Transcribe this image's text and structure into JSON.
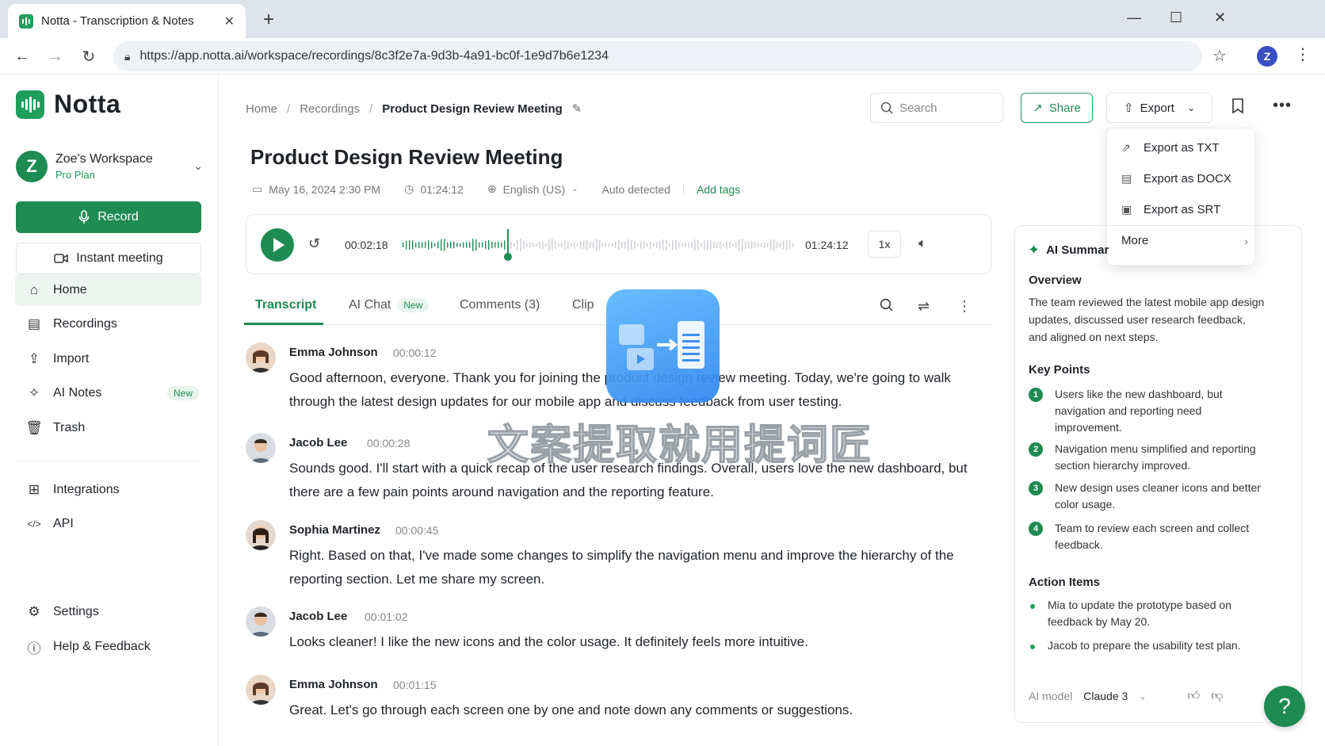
{
  "browser": {
    "tab_title": "Notta - Transcription & Notes",
    "url": "https://app.notta.ai/workspace/recordings/8c3f2e7a-9d3b-4a91-bc0f-1e9d7b6e1234",
    "profile_initial": "Z"
  },
  "sidebar": {
    "brand": "Notta",
    "workspace_name": "Zoe's Workspace",
    "workspace_plan": "Pro Plan",
    "workspace_initial": "Z",
    "record_label": "Record",
    "instant_label": "Instant meeting",
    "nav": [
      {
        "label": "Home",
        "icon": "home-icon"
      },
      {
        "label": "Recordings",
        "icon": "document-icon"
      },
      {
        "label": "Import",
        "icon": "upload-icon"
      },
      {
        "label": "AI Notes",
        "icon": "sparkle-icon",
        "badge": "New"
      },
      {
        "label": "Trash",
        "icon": "trash-icon"
      },
      {
        "label": "Integrations",
        "icon": "grid-icon"
      },
      {
        "label": "API",
        "icon": "code-icon"
      },
      {
        "label": "Settings",
        "icon": "gear-icon"
      },
      {
        "label": "Help & Feedback",
        "icon": "help-icon"
      }
    ]
  },
  "header": {
    "breadcrumb": [
      "Home",
      "Recordings",
      "Product Design Review Meeting"
    ],
    "search_placeholder": "Search",
    "share_label": "Share",
    "export_label": "Export"
  },
  "recording": {
    "title": "Product Design Review Meeting",
    "date": "May 16, 2024 2:30 PM",
    "duration": "01:24:12",
    "language": "English (US)",
    "detection": "Auto detected",
    "add_tags": "Add tags"
  },
  "player": {
    "current_time": "00:02:18",
    "total_time": "01:24:12",
    "speed": "1x",
    "progress": 0.27
  },
  "tabs": [
    {
      "label": "Transcript"
    },
    {
      "label": "AI Chat",
      "badge": "New"
    },
    {
      "label": "Comments (3)"
    },
    {
      "label": "Clip"
    }
  ],
  "transcript": [
    {
      "speaker": "Emma Johnson",
      "time": "00:00:12",
      "text": "Good afternoon, everyone. Thank you for joining the product design review meeting. Today, we're going to walk through the latest design updates for our mobile app and discuss feedback from user testing."
    },
    {
      "speaker": "Jacob Lee",
      "time": "00:00:28",
      "text": "Sounds good. I'll start with a quick recap of the user research findings. Overall, users love the new dashboard, but there are a few pain points around navigation and the reporting feature."
    },
    {
      "speaker": "Sophia Martinez",
      "time": "00:00:45",
      "text": "Right. Based on that, I've made some changes to simplify the navigation menu and improve the hierarchy of the reporting section. Let me share my screen."
    },
    {
      "speaker": "Jacob Lee",
      "time": "00:01:02",
      "text": "Looks cleaner! I like the new icons and the color usage. It definitely feels more intuitive."
    },
    {
      "speaker": "Emma Johnson",
      "time": "00:01:15",
      "text": "Great. Let's go through each screen one by one and note down any comments or suggestions."
    }
  ],
  "overlay_text": "文案提取就用提词匠",
  "summary": {
    "title": "AI Summar",
    "overview_heading": "Overview",
    "overview": "The team reviewed the latest mobile app design updates, discussed user research feedback, and aligned on next steps.",
    "keypoints_heading": "Key Points",
    "keypoints": [
      {
        "num": "1",
        "text": "Users like the new dashboard, but navigation and reporting need improvement."
      },
      {
        "num": "2",
        "text": "Navigation menu simplified and reporting section hierarchy improved."
      },
      {
        "num": "3",
        "text": "New design uses cleaner icons and better color usage."
      },
      {
        "num": "4",
        "text": "Team to review each screen and collect feedback."
      }
    ],
    "actions_heading": "Action Items",
    "actions": [
      "Mia to update the prototype based on feedback by May 20.",
      "Jacob to prepare the usability test plan."
    ],
    "model_label": "AI model",
    "model_value": "Claude 3"
  },
  "export_menu": {
    "items": [
      "Export as TXT",
      "Export as DOCX",
      "Export as SRT",
      "More"
    ]
  },
  "colors": {
    "brand": "#1e8b52",
    "accent": "#1e9e5c"
  }
}
